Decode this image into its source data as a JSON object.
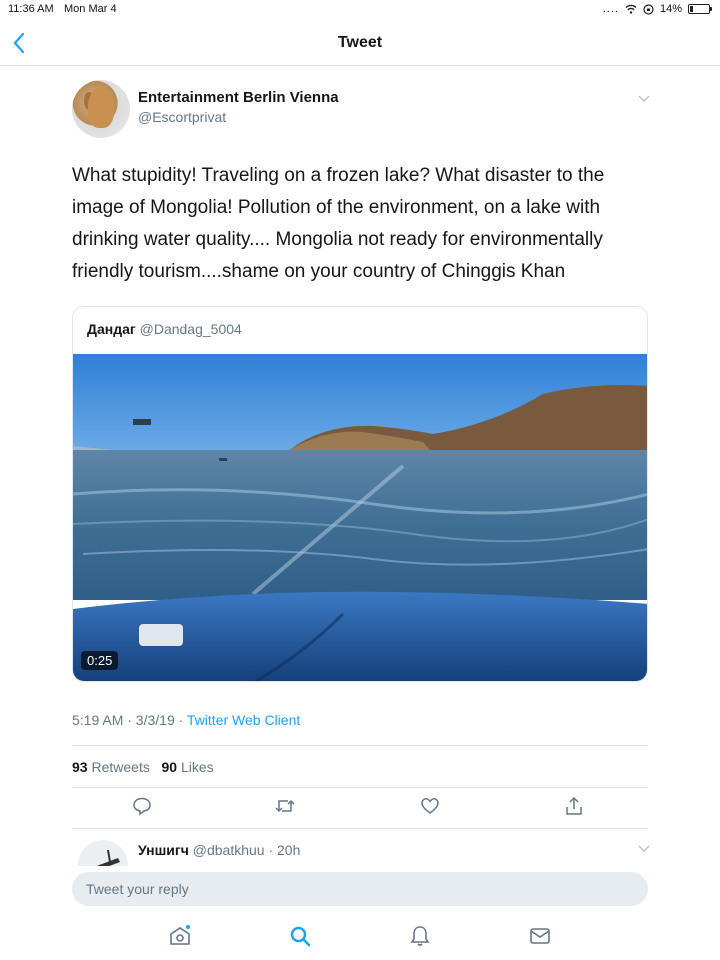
{
  "status_bar": {
    "time": "11:36 AM",
    "date": "Mon Mar 4",
    "battery": "14%"
  },
  "nav": {
    "title": "Tweet"
  },
  "tweet": {
    "author_name": "Entertainment Berlin Vienna",
    "author_handle": "@Escortprivat",
    "text": "What stupidity! Traveling on a frozen lake? What disaster to the image of Mongolia! Pollution of the environment, on a lake with drinking water quality.... Mongolia not ready for environmentally friendly tourism....shame on your country of Chinggis Khan",
    "quoted": {
      "name": "Дандаг",
      "handle": "@Dandag_5004",
      "video_duration": "0:25"
    },
    "timestamp": "5:19 AM · 3/3/19 · ",
    "client": "Twitter Web Client",
    "retweets_count": "93",
    "retweets_label": "Retweets",
    "likes_count": "90",
    "likes_label": "Likes"
  },
  "reply_preview": {
    "name": "Уншигч",
    "handle_time": "@dbatkhuu · 20h"
  },
  "compose": {
    "placeholder": "Tweet your reply"
  },
  "colors": {
    "accent": "#1da1f2",
    "secondary_text": "#657786",
    "divider": "#e1e8ed"
  },
  "icons": {
    "actions": [
      "reply-icon",
      "retweet-icon",
      "like-icon",
      "share-icon"
    ],
    "tabs": [
      "home-icon",
      "search-icon",
      "notifications-icon",
      "messages-icon"
    ]
  }
}
